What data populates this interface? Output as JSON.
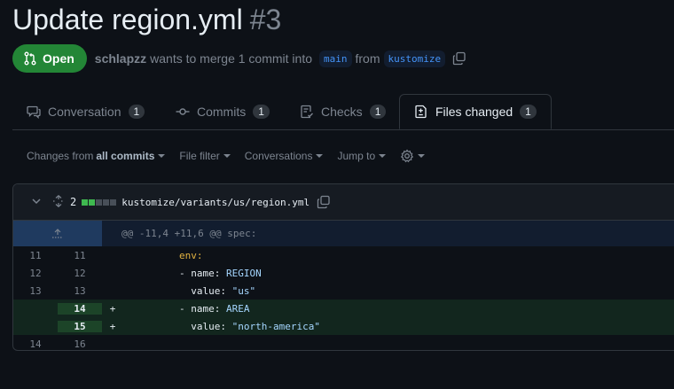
{
  "pr": {
    "title": "Update region.yml",
    "number": "#3",
    "state": "Open",
    "author": "schlapzz",
    "text_merge": "wants to merge 1 commit into",
    "base_branch": "main",
    "text_from": "from",
    "head_branch": "kustomize"
  },
  "tabs": [
    {
      "label": "Conversation",
      "count": "1"
    },
    {
      "label": "Commits",
      "count": "1"
    },
    {
      "label": "Checks",
      "count": "1"
    },
    {
      "label": "Files changed",
      "count": "1"
    }
  ],
  "toolbar": {
    "changes_prefix": "Changes from",
    "changes_value": "all commits",
    "file_filter": "File filter",
    "conversations": "Conversations",
    "jump_to": "Jump to"
  },
  "file": {
    "change_count": "2",
    "path": "kustomize/variants/us/region.yml",
    "hunk_header": "@@ -11,4 +11,6 @@ spec:",
    "lines": [
      {
        "old": "11",
        "new": "11",
        "sign": "",
        "indent": "        ",
        "key": "env:",
        "rest": ""
      },
      {
        "old": "12",
        "new": "12",
        "sign": "",
        "indent": "        - ",
        "key": "name:",
        "rest": " REGION"
      },
      {
        "old": "13",
        "new": "13",
        "sign": "",
        "indent": "          ",
        "key": "value:",
        "rest": " \"us\""
      },
      {
        "old": "",
        "new": "14",
        "sign": "+",
        "indent": "        - ",
        "key": "name:",
        "rest": " AREA"
      },
      {
        "old": "",
        "new": "15",
        "sign": "+",
        "indent": "          ",
        "key": "value:",
        "rest": " \"north-america\""
      },
      {
        "old": "14",
        "new": "16",
        "sign": "",
        "indent": "",
        "key": "",
        "rest": ""
      }
    ]
  },
  "colors": {
    "accent": "#4493f8",
    "open": "#238636",
    "added": "#3fb950"
  }
}
